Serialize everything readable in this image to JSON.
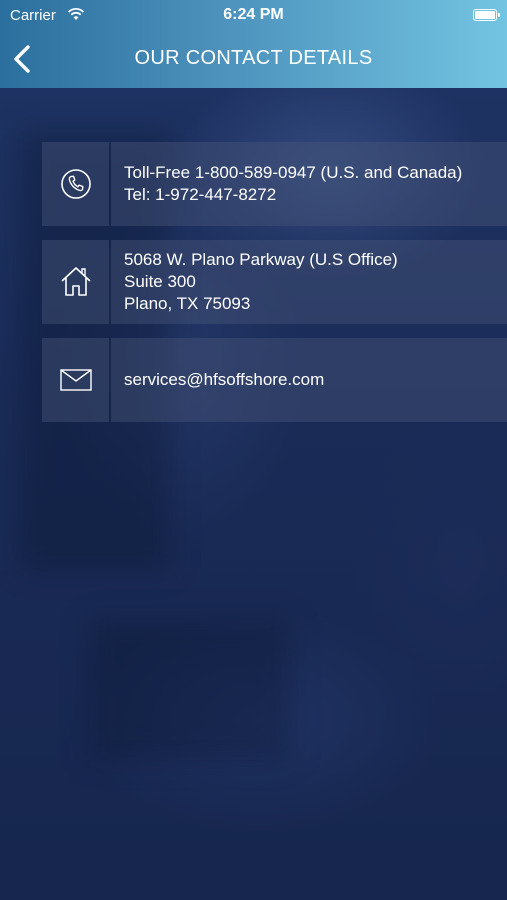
{
  "status_bar": {
    "carrier": "Carrier",
    "time": "6:24 PM",
    "wifi_icon": "wifi-icon",
    "battery_icon": "battery-icon"
  },
  "nav": {
    "title": "OUR CONTACT DETAILS",
    "back_icon": "chevron-left-icon"
  },
  "contacts": {
    "phone": {
      "icon": "phone-icon",
      "lines": [
        "Toll-Free 1-800-589-0947 (U.S. and Canada)",
        "Tel: 1-972-447-8272"
      ]
    },
    "address": {
      "icon": "home-icon",
      "lines": [
        "5068 W. Plano Parkway (U.S Office)",
        "Suite 300",
        "Plano, TX 75093"
      ]
    },
    "email": {
      "icon": "envelope-icon",
      "lines": [
        "services@hfsoffshore.com"
      ]
    }
  },
  "colors": {
    "header_start": "#2b6f9e",
    "header_end": "#73c4e2",
    "background": "#1a2a52",
    "row_fill": "rgba(70,85,120,0.45)",
    "text": "#ffffff"
  }
}
